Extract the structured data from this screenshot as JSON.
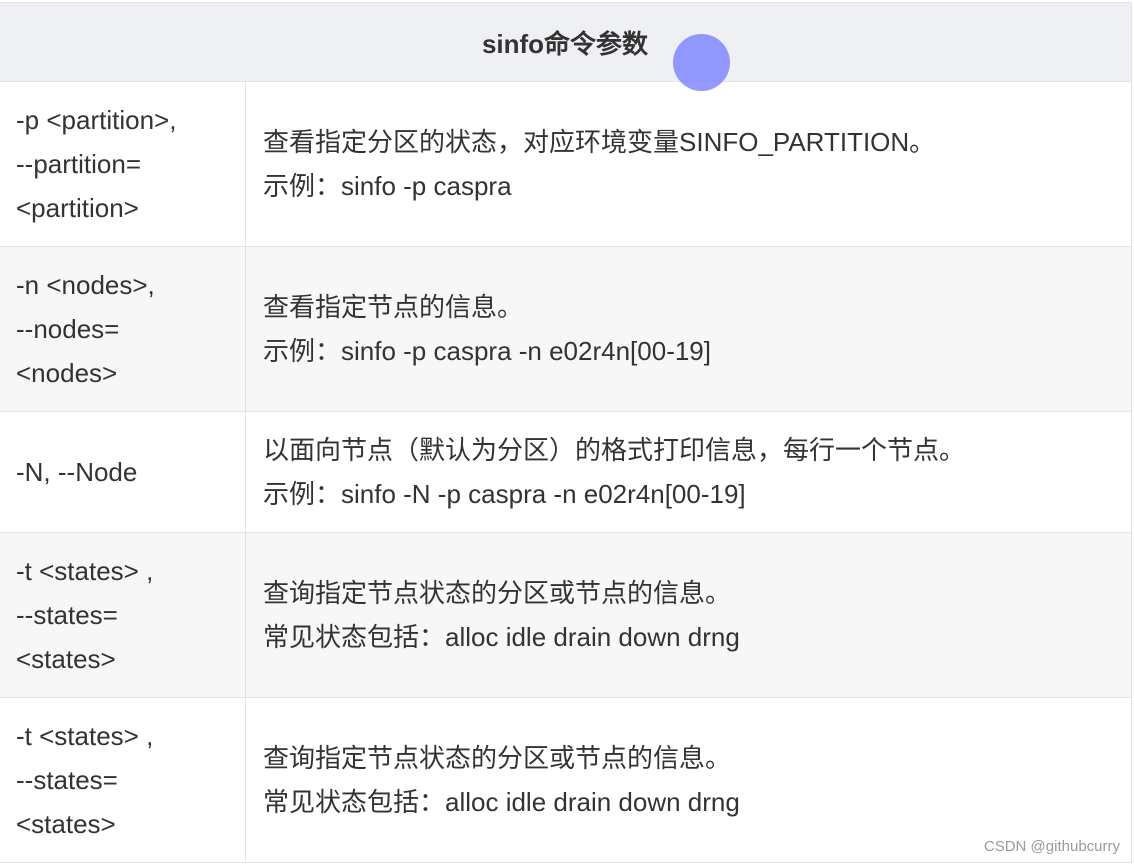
{
  "table": {
    "header": "sinfo命令参数",
    "rows": [
      {
        "option_lines": [
          "-p <partition>,",
          "--partition=",
          "<partition>"
        ],
        "desc_lines": [
          "查看指定分区的状态，对应环境变量SINFO_PARTITION。",
          "示例：sinfo -p caspra"
        ]
      },
      {
        "option_lines": [
          "-n <nodes>,",
          "--nodes=",
          "<nodes>"
        ],
        "desc_lines": [
          "查看指定节点的信息。",
          "示例：sinfo -p caspra -n e02r4n[00-19]"
        ]
      },
      {
        "option_lines": [
          "-N, --Node"
        ],
        "desc_lines": [
          "以面向节点（默认为分区）的格式打印信息，每行一个节点。",
          "示例：sinfo -N -p caspra -n e02r4n[00-19]"
        ]
      },
      {
        "option_lines": [
          "-t <states> ,",
          "--states=",
          "<states>"
        ],
        "desc_lines": [
          "查询指定节点状态的分区或节点的信息。",
          "常见状态包括：alloc idle drain down drng"
        ]
      },
      {
        "option_lines": [
          "-t <states> ,",
          "--states=",
          "<states>"
        ],
        "desc_lines": [
          "查询指定节点状态的分区或节点的信息。",
          "常见状态包括：alloc idle drain down drng"
        ]
      }
    ]
  },
  "watermark": "CSDN @githubcurry",
  "colors": {
    "header_bg": "#eef0f4",
    "row_shade": "#f7f7f7",
    "border": "#e1e4e8",
    "cursor_dot": "#787eff"
  }
}
